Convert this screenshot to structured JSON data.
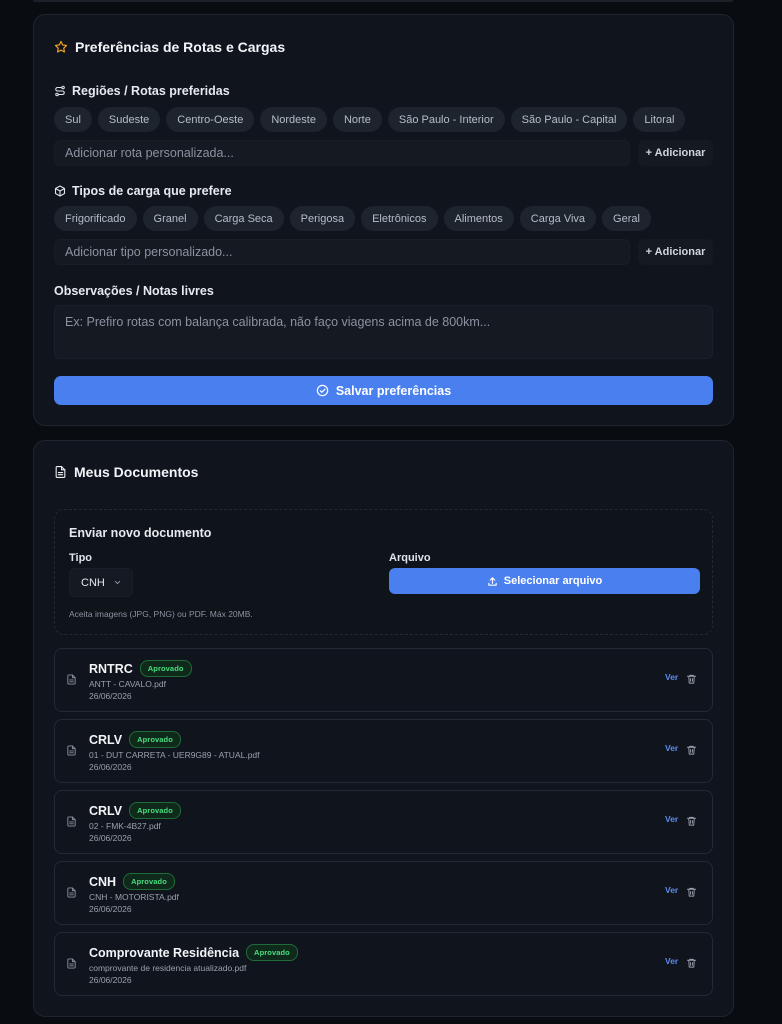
{
  "preferences": {
    "title": "Preferências de Rotas e Cargas",
    "regions": {
      "label": "Regiões / Rotas preferidas",
      "chips": [
        "Sul",
        "Sudeste",
        "Centro-Oeste",
        "Nordeste",
        "Norte",
        "São Paulo - Interior",
        "São Paulo - Capital",
        "Litoral"
      ],
      "input_placeholder": "Adicionar rota personalizada...",
      "add_label": "+ Adicionar"
    },
    "cargo": {
      "label": "Tipos de carga que prefere",
      "chips": [
        "Frigorificado",
        "Granel",
        "Carga Seca",
        "Perigosa",
        "Eletrônicos",
        "Alimentos",
        "Carga Viva",
        "Geral"
      ],
      "input_placeholder": "Adicionar tipo personalizado...",
      "add_label": "+ Adicionar"
    },
    "notes": {
      "label": "Observações / Notas livres",
      "placeholder": "Ex: Prefiro rotas com balança calibrada, não faço viagens acima de 800km..."
    },
    "save_label": "Salvar preferências",
    "icons": {
      "title": "star-icon",
      "regions": "route-icon",
      "cargo": "package-icon",
      "save": "check-circle-icon"
    },
    "accent_color": "#f5a524"
  },
  "documents": {
    "title": "Meus Documentos",
    "upload": {
      "title": "Enviar novo documento",
      "type_label": "Tipo",
      "type_value": "CNH",
      "file_label": "Arquivo",
      "file_button": "Selecionar arquivo",
      "hint": "Aceita imagens (JPG, PNG) ou PDF. Máx 20MB."
    },
    "items": [
      {
        "name": "RNTRC",
        "status": "Aprovado",
        "file": "ANTT - CAVALO.pdf",
        "date": "26/06/2026",
        "view": "Ver"
      },
      {
        "name": "CRLV",
        "status": "Aprovado",
        "file": "01 - DUT CARRETA - UER9G89 - ATUAL.pdf",
        "date": "26/06/2026",
        "view": "Ver"
      },
      {
        "name": "CRLV",
        "status": "Aprovado",
        "file": "02 - FMK-4B27.pdf",
        "date": "26/06/2026",
        "view": "Ver"
      },
      {
        "name": "CNH",
        "status": "Aprovado",
        "file": "CNH - MOTORISTA.pdf",
        "date": "26/06/2026",
        "view": "Ver"
      },
      {
        "name": "Comprovante Residência",
        "status": "Aprovado",
        "file": "comprovante de residencia atualizado.pdf",
        "date": "26/06/2026",
        "view": "Ver"
      }
    ],
    "status_color": "#4ade80",
    "button_color": "#4a7ff0"
  }
}
